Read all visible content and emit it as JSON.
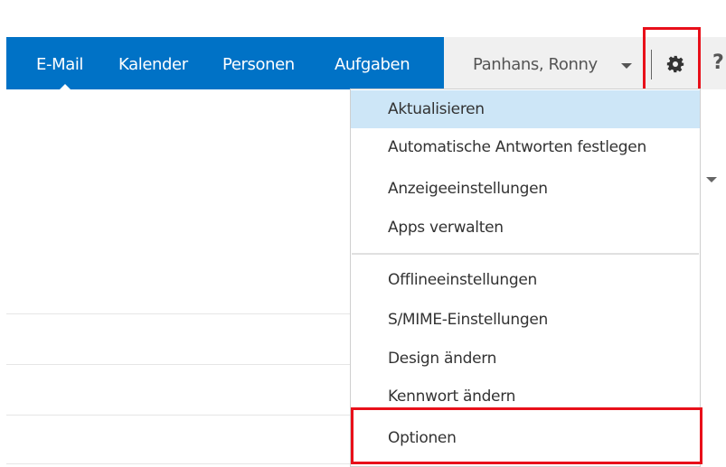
{
  "nav": {
    "items": [
      {
        "label": "E-Mail"
      },
      {
        "label": "Kalender"
      },
      {
        "label": "Personen"
      },
      {
        "label": "Aufgaben"
      }
    ]
  },
  "user": {
    "name": "Panhans, Ronny"
  },
  "icons": {
    "settings": "gear-icon",
    "help": "help-icon"
  },
  "colors": {
    "header": "#0072c6",
    "highlight_box": "#e8101a",
    "active_item": "#cde6f7"
  },
  "menu": {
    "items": [
      {
        "label": "Aktualisieren",
        "active": true
      },
      {
        "label": "Automatische Antworten festlegen"
      },
      {
        "label": "Anzeigeeinstellungen"
      },
      {
        "label": "Apps verwalten"
      },
      {
        "label": "Offlineeinstellungen"
      },
      {
        "label": "S/MIME-Einstellungen"
      },
      {
        "label": "Design ändern"
      },
      {
        "label": "Kennwort ändern"
      },
      {
        "label": "Optionen"
      }
    ]
  }
}
